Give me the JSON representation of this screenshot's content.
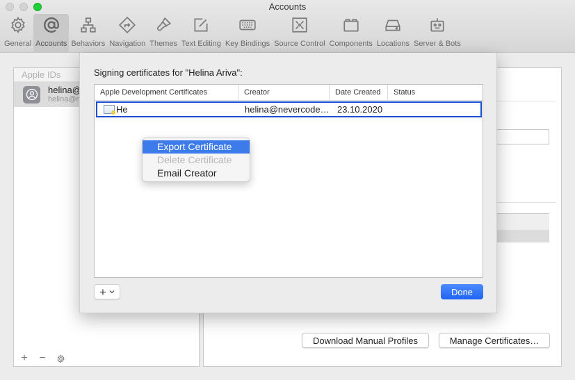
{
  "window": {
    "title": "Accounts"
  },
  "toolbar": {
    "items": [
      {
        "label": "General",
        "icon": "gear-icon"
      },
      {
        "label": "Accounts",
        "icon": "at-sign-icon",
        "active": true
      },
      {
        "label": "Behaviors",
        "icon": "hierarchy-icon"
      },
      {
        "label": "Navigation",
        "icon": "navigation-arrow-icon"
      },
      {
        "label": "Themes",
        "icon": "paintbrush-icon"
      },
      {
        "label": "Text Editing",
        "icon": "edit-square-icon"
      },
      {
        "label": "Key Bindings",
        "icon": "keyboard-icon"
      },
      {
        "label": "Source Control",
        "icon": "source-control-icon"
      },
      {
        "label": "Components",
        "icon": "components-icon"
      },
      {
        "label": "Locations",
        "icon": "drive-icon"
      },
      {
        "label": "Server & Bots",
        "icon": "robot-icon"
      }
    ]
  },
  "accounts_list": {
    "header": "Apple IDs",
    "items": [
      {
        "name": "helina@",
        "email": "helina@n"
      }
    ],
    "footer": {
      "add": "+",
      "remove": "−"
    }
  },
  "detail": {
    "download_button": "Download Manual Profiles",
    "manage_button": "Manage Certificates…"
  },
  "sheet": {
    "title": "Signing certificates for \"Helina Ariva\":",
    "columns": [
      "Apple Development Certificates",
      "Creator",
      "Date Created",
      "Status"
    ],
    "rows": [
      {
        "name": "He",
        "creator": "helina@nevercode…",
        "date": "23.10.2020",
        "status": ""
      }
    ],
    "context_menu": [
      {
        "label": "Export Certificate",
        "state": "highlighted"
      },
      {
        "label": "Delete Certificate",
        "state": "disabled"
      },
      {
        "label": "Email Creator",
        "state": "normal"
      }
    ],
    "add_label": "+",
    "done_label": "Done"
  },
  "colors": {
    "accent": "#1f63f5",
    "highlight": "#3d7bea",
    "selection_border": "#1a4fd6"
  }
}
